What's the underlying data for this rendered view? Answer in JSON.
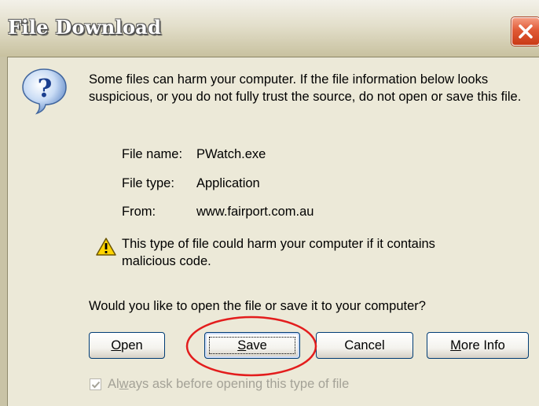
{
  "window": {
    "title": "File Download"
  },
  "message": "Some files can harm your computer. If the file information below looks suspicious, or you do not fully trust the source, do not open or save this file.",
  "file_info": {
    "name_label": "File name:",
    "name_value": "PWatch.exe",
    "type_label": "File type:",
    "type_value": "Application",
    "from_label": "From:",
    "from_value": "www.fairport.com.au"
  },
  "warning": "This type of file could harm your computer if it contains malicious code.",
  "question": "Would you like to open the file or save it to your computer?",
  "buttons": {
    "open_mnemonic": "O",
    "open_rest": "pen",
    "save_mnemonic": "S",
    "save_rest": "ave",
    "cancel": "Cancel",
    "more_mnemonic": "M",
    "more_rest": "ore Info"
  },
  "checkbox": {
    "pre": "Al",
    "mnemonic": "w",
    "post": "ays ask before opening this type of file",
    "checked": true,
    "enabled": false
  },
  "icons": {
    "question": "question-icon",
    "warning": "warning-icon",
    "close": "close-icon",
    "check": "checkmark-icon"
  },
  "colors": {
    "dialog_bg": "#ece9d8",
    "button_border": "#003c74",
    "highlight_ellipse": "#e31d1d",
    "close_button": "#e15a36"
  }
}
